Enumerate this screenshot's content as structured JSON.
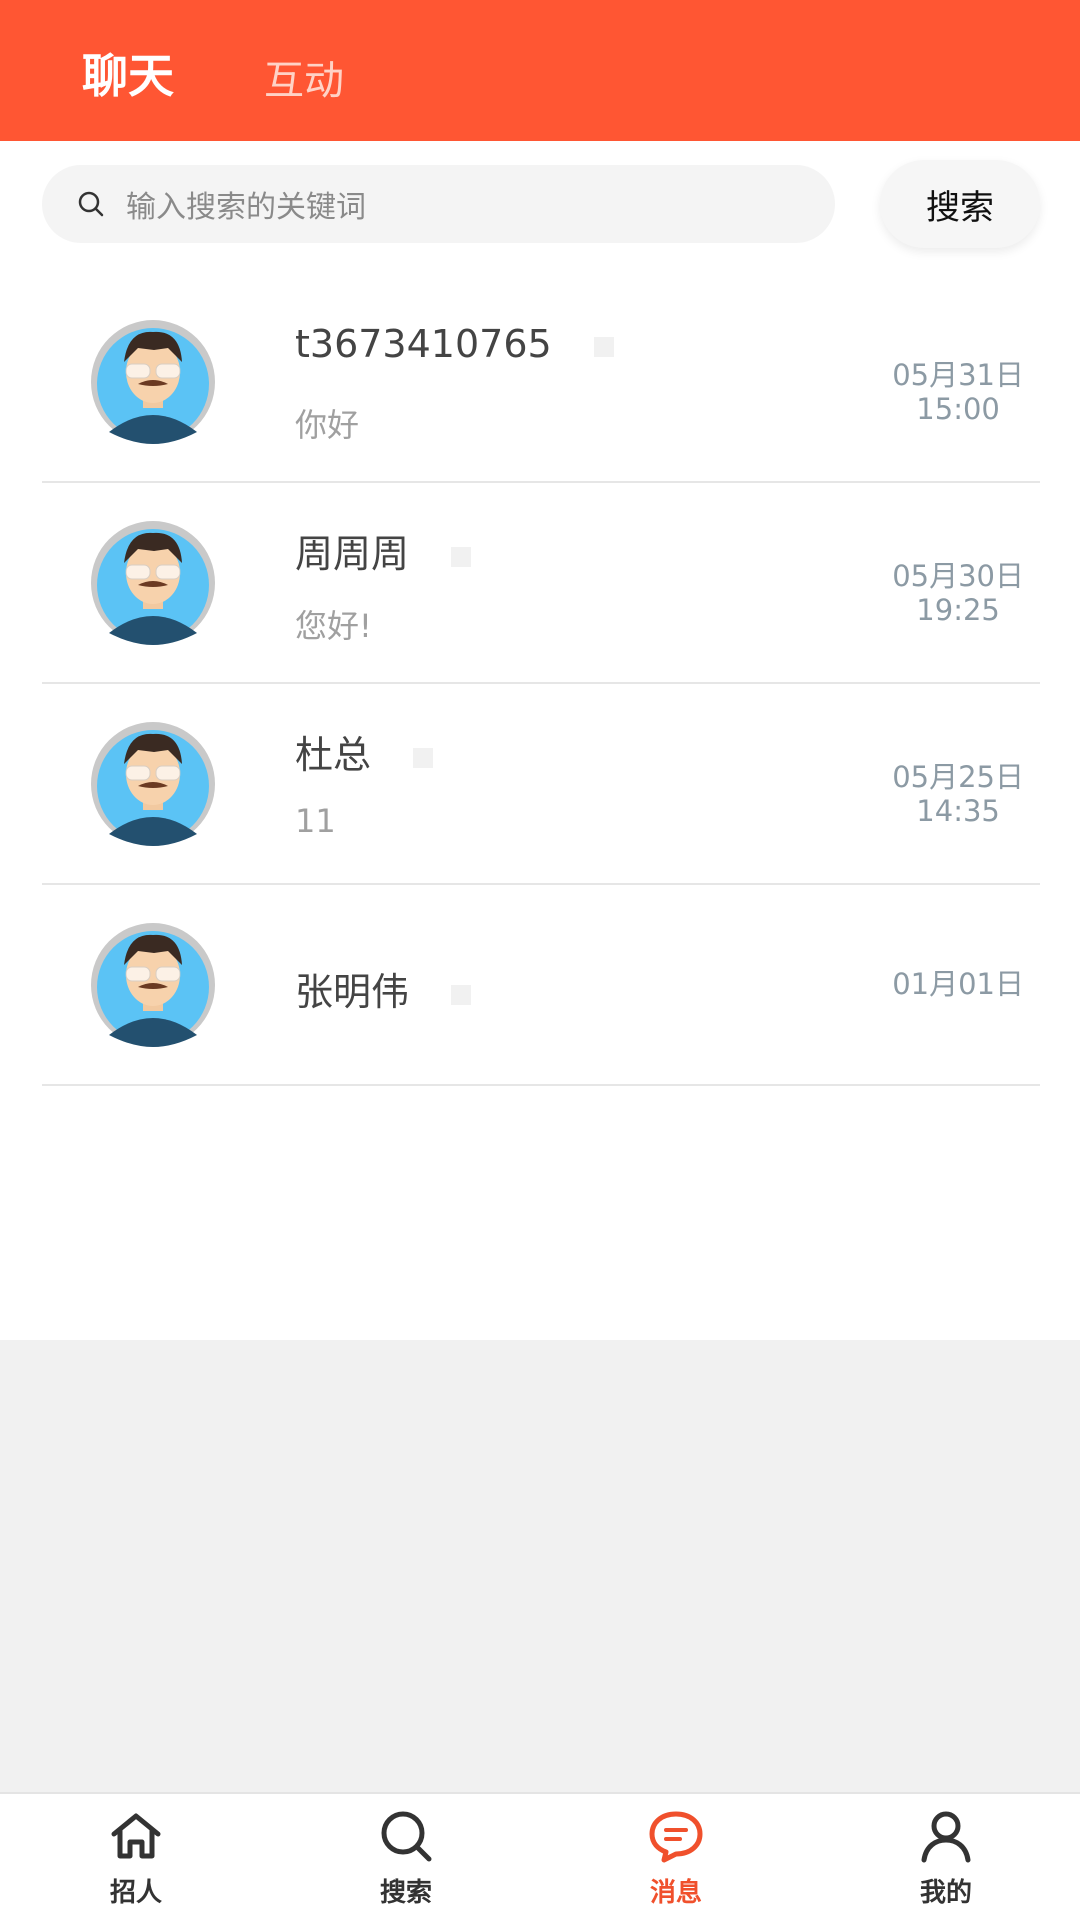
{
  "header": {
    "tabs": [
      {
        "label": "聊天",
        "active": true
      },
      {
        "label": "互动",
        "active": false
      }
    ],
    "bg_color": "#ff5633"
  },
  "search": {
    "placeholder": "输入搜索的关键词",
    "button_label": "搜索"
  },
  "chats": [
    {
      "name": "t3673410765",
      "message": "你好",
      "date": "05月31日",
      "time": "15:00"
    },
    {
      "name": "周周周",
      "message": "您好!",
      "date": "05月30日",
      "time": "19:25"
    },
    {
      "name": "杜总",
      "message": "11",
      "date": "05月25日",
      "time": "14:35"
    },
    {
      "name": "张明伟",
      "message": "",
      "date": "01月01日",
      "time": ""
    }
  ],
  "bottom_nav": {
    "items": [
      {
        "label": "招人",
        "icon": "home-icon",
        "active": false
      },
      {
        "label": "搜索",
        "icon": "search-icon",
        "active": false
      },
      {
        "label": "消息",
        "icon": "chat-bubble-icon",
        "active": true
      },
      {
        "label": "我的",
        "icon": "user-icon",
        "active": false
      }
    ],
    "active_color": "#f0502c"
  }
}
